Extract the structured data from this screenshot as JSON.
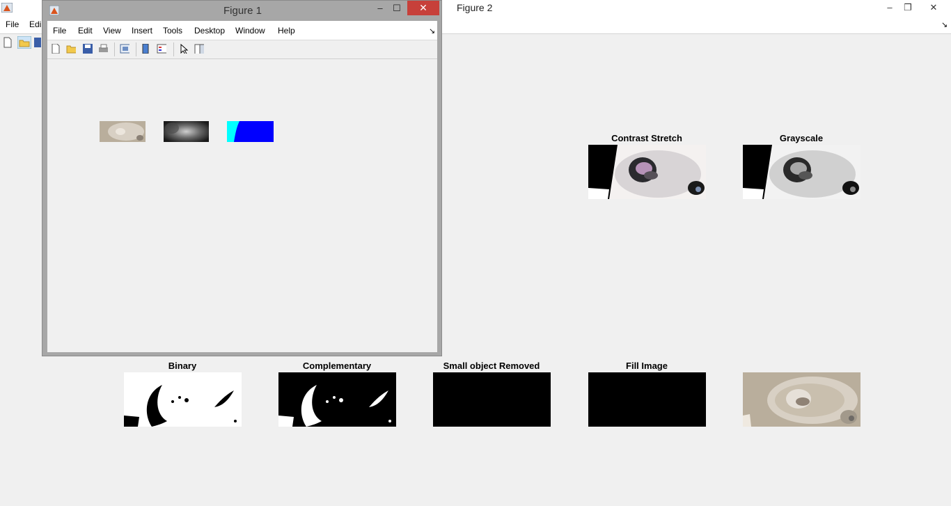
{
  "figure2": {
    "title": "Figure 2",
    "menu": [
      "File",
      "Edi"
    ],
    "axes": [
      {
        "title": "Contrast Stretch",
        "image": "contrast-stretch"
      },
      {
        "title": "Grayscale",
        "image": "grayscale"
      },
      {
        "title": "Binary",
        "image": "binary"
      },
      {
        "title": "Complementary",
        "image": "complementary"
      },
      {
        "title": "Small object Removed",
        "image": "small-object-removed"
      },
      {
        "title": "Fill Image",
        "image": "fill-image"
      },
      {
        "title": "",
        "image": "original"
      }
    ]
  },
  "figure1": {
    "title": "Figure 1",
    "menu": [
      "File",
      "Edit",
      "View",
      "Insert",
      "Tools",
      "Desktop",
      "Window",
      "Help"
    ],
    "toolbar_icons": [
      "new-figure-icon",
      "open-file-icon",
      "save-icon",
      "print-icon",
      "link-plot-icon",
      "insert-colorbar-icon",
      "insert-legend-icon",
      "edit-plot-arrow-icon",
      "show-plot-tools-icon"
    ],
    "thumbnails": [
      "original-thumb",
      "blurred-gray-thumb",
      "cyan-blue-thumb"
    ]
  },
  "window_buttons": {
    "minimize": "–",
    "restore": "❐",
    "maximize": "☐",
    "close": "✕",
    "dock": "↘"
  },
  "colors": {
    "close_red": "#c7403a",
    "cyan": "#00ffff",
    "blue": "#0000ff"
  }
}
